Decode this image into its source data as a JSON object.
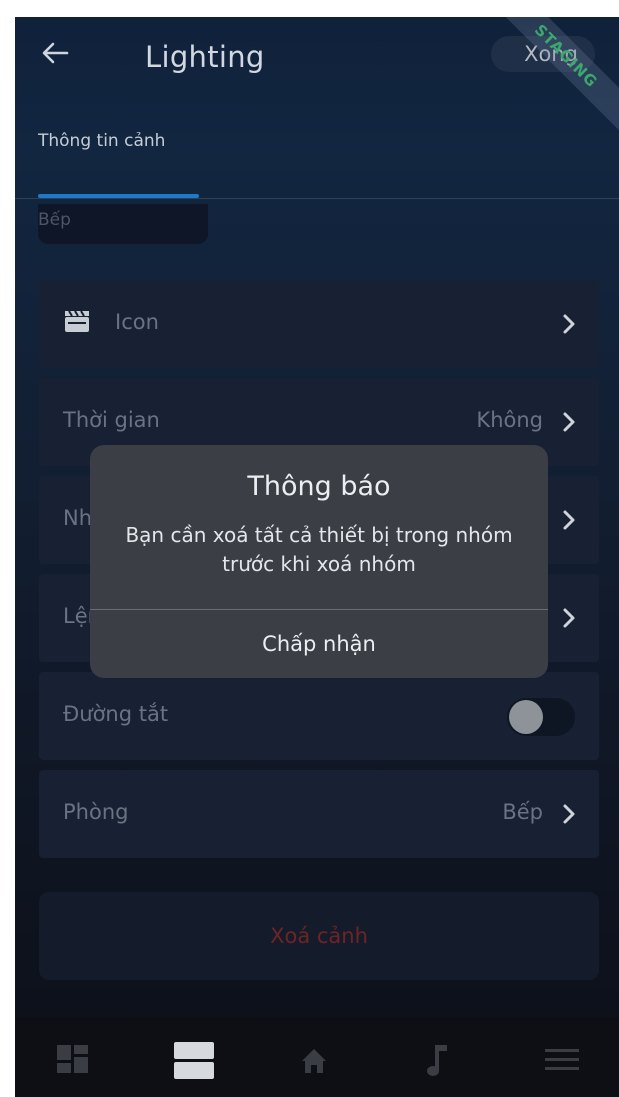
{
  "header": {
    "title": "Lighting",
    "done_label": "Xong",
    "staging_label": "STAGING"
  },
  "tabs": {
    "active_label": "Thông tin cảnh"
  },
  "scene_name": "Bếp",
  "rows": {
    "icon": {
      "label": "Icon"
    },
    "time": {
      "label": "Thời gian",
      "value": "Không"
    },
    "group": {
      "label": "Nhóm"
    },
    "command": {
      "label": "Lệnh"
    },
    "shortcut": {
      "label": "Đường tắt",
      "toggle_on": false
    },
    "room": {
      "label": "Phòng",
      "value": "Bếp"
    }
  },
  "delete_label": "Xoá cảnh",
  "dialog": {
    "title": "Thông báo",
    "message": "Bạn cần xoá tất cả thiết bị trong nhóm trước khi xoá nhóm",
    "action": "Chấp nhận"
  },
  "colors": {
    "accent": "#1f78c8",
    "danger": "#6e2424",
    "staging": "#3ba86c"
  },
  "bottom_nav": [
    "dashboard-icon",
    "scenes-icon",
    "home-icon",
    "music-icon",
    "menu-icon"
  ]
}
